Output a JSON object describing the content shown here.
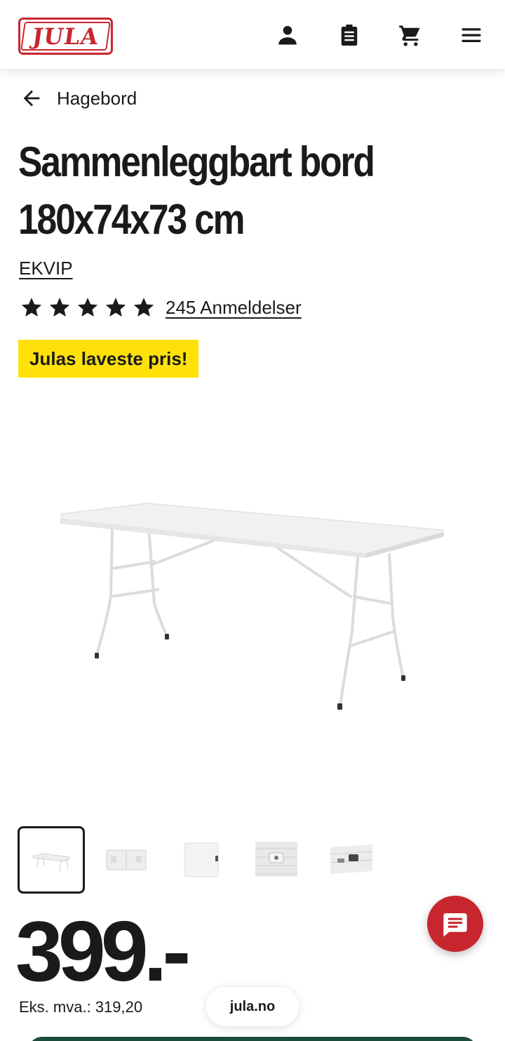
{
  "header": {
    "logo_text": "JULA",
    "brand_color": "#c8262e",
    "icons": [
      "account-icon",
      "shopping-list-icon",
      "cart-icon",
      "menu-icon"
    ]
  },
  "breadcrumb": {
    "label": "Hagebord"
  },
  "product": {
    "title_line1": "Sammenleggbart bord",
    "title_line2": "180x74x73 cm",
    "brand": "EKVIP",
    "rating": 5,
    "reviews_label": "245 Anmeldelser",
    "badge": "Julas laveste pris!",
    "badge_color": "#ffe10a",
    "image_count": 5,
    "price": "399.-",
    "price_ex_vat": "Eks. mva.: 319,20"
  },
  "footer": {
    "domain": "jula.no"
  }
}
